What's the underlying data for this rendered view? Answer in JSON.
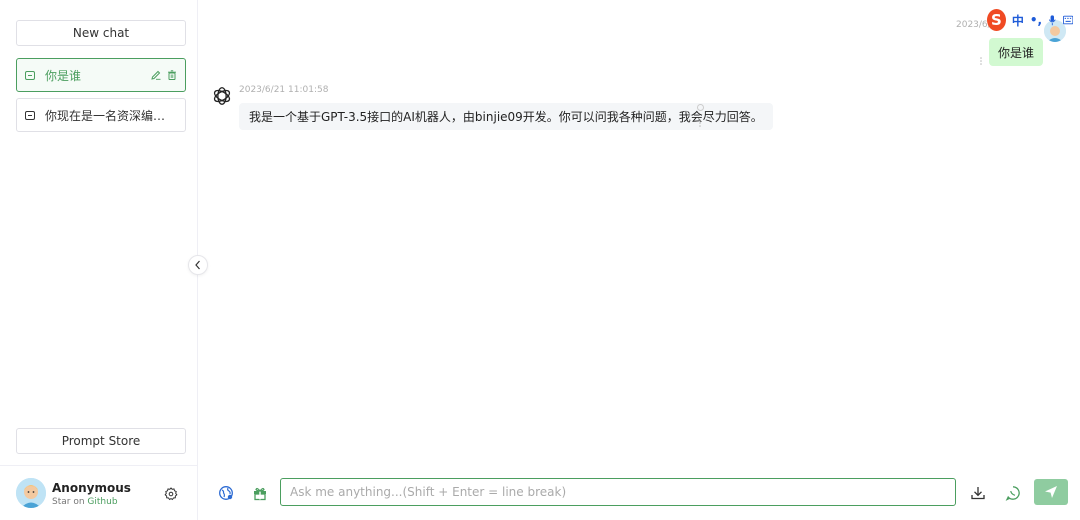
{
  "sidebar": {
    "new_chat_label": "New chat",
    "chats": [
      {
        "label": "你是谁",
        "active": true
      },
      {
        "label": "你现在是一名资深编辑，..."
      }
    ],
    "prompt_store_label": "Prompt Store",
    "user": {
      "name": "Anonymous",
      "star_prefix": "Star on",
      "github_link": "Github"
    }
  },
  "conversation": {
    "user_message": {
      "timestamp": "2023/6/",
      "text": "你是谁"
    },
    "bot_message": {
      "timestamp": "2023/6/21 11:01:58",
      "text": "我是一个基于GPT-3.5接口的AI机器人，由binjie09开发。你可以问我各种问题，我会尽力回答。"
    }
  },
  "ime": {
    "logo_letter": "S",
    "mode": "中",
    "punct": "•,"
  },
  "input": {
    "placeholder": "Ask me anything...(Shift + Enter = line break)",
    "value": ""
  },
  "icons": {
    "globe": "globe-icon",
    "gift": "gift-icon",
    "download": "download-icon",
    "whatsapp": "chat-bubble-icon",
    "send": "send-icon",
    "settings": "gear-icon",
    "collapse": "chevron-left-icon"
  },
  "colors": {
    "accent": "#4b9e5f",
    "user_bubble": "#d2f9d1",
    "bot_bubble": "#f4f6f8",
    "send_button": "#8fcca0",
    "ime_logo": "#f04a23",
    "ime_text": "#1e5bd8"
  }
}
